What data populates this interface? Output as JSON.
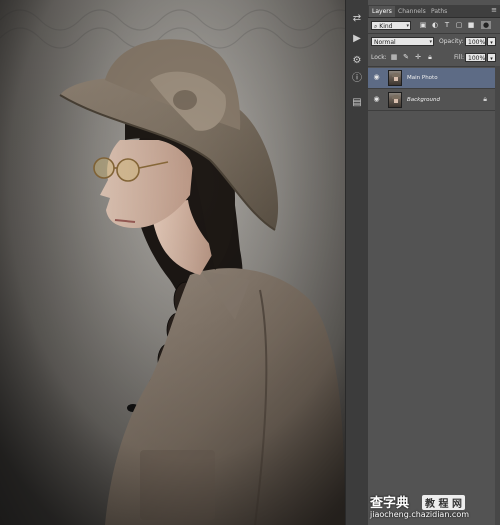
{
  "panel": {
    "tabs": [
      {
        "label": "Layers",
        "active": true
      },
      {
        "label": "Channels",
        "active": false
      },
      {
        "label": "Paths",
        "active": false
      }
    ],
    "menu_icon": "panel-menu-icon",
    "filter": {
      "kind_label": "⌕ Kind"
    },
    "blend_mode": "Normal",
    "opacity_label": "Opacity:",
    "opacity_value": "100%",
    "lock_label": "Lock:",
    "fill_label": "Fill:",
    "fill_value": "100%",
    "layers": [
      {
        "name": "Main Photo",
        "selected": true,
        "locked": false
      },
      {
        "name": "Background",
        "selected": false,
        "locked": true
      }
    ]
  },
  "toolstrip": {
    "tools": [
      "history-icon",
      "play-icon",
      "adjustments-icon",
      "info-icon",
      "layer-comps-icon"
    ]
  },
  "watermark": {
    "main": "查字典",
    "sub": "教 程 网",
    "url": "jiaocheng.chazidian.com"
  },
  "colors": {
    "panel_bg": "#535353",
    "selected_layer": "#5d6b85",
    "tab_bar": "#3f3f3f"
  }
}
